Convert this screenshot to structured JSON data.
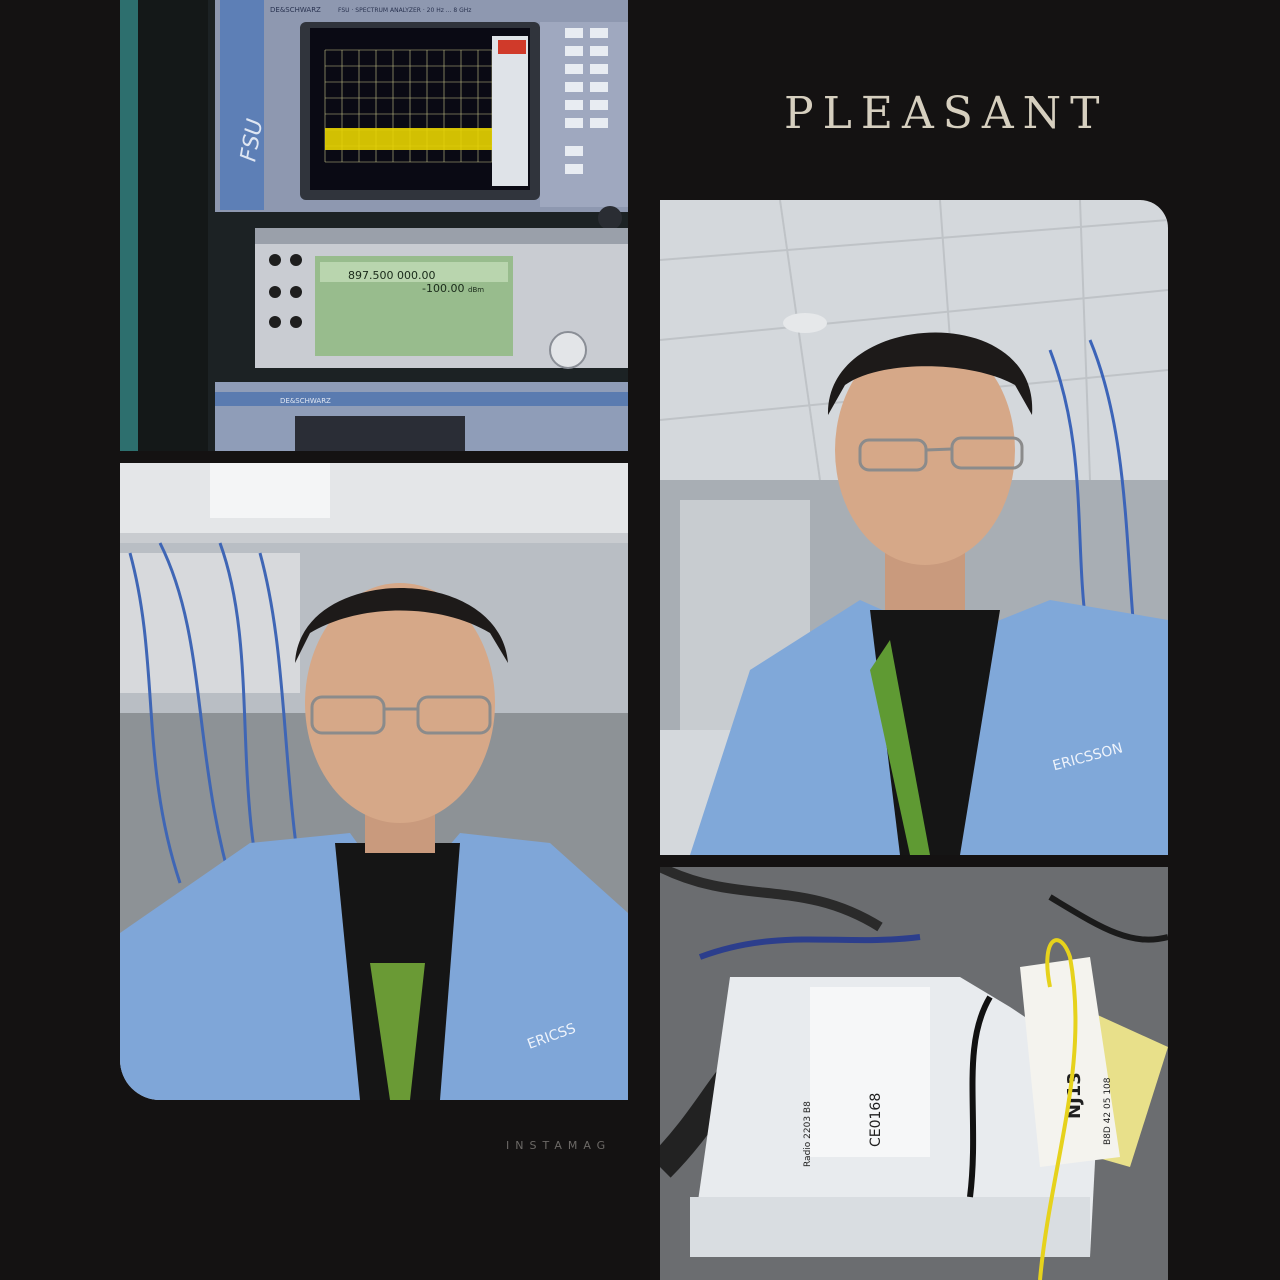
{
  "collage": {
    "title": "PLEASANT",
    "watermark": "INSTAMAG"
  },
  "instrument_panel": {
    "brand_text": "DE&SCHWARZ",
    "analyzer_model": "FSU",
    "analyzer_header": "FSU · SPECTRUM ANALYZER · 20 Hz ... 8 GHz",
    "generator_frequency": "897.500 000.00",
    "generator_level": "-100.00",
    "generator_unit": "dBm",
    "lower_brand_text": "DE&SCHWARZ"
  },
  "selfie_left": {
    "coat_logo_text": "ERICSS"
  },
  "selfie_right": {
    "coat_logo_text": "ERICSSON"
  },
  "radio_unit": {
    "product_label": "Radio 2203 B8",
    "ce_mark": "CE0168",
    "tag_text": "NJ13",
    "tag_code": "B8D 42 05 108"
  }
}
